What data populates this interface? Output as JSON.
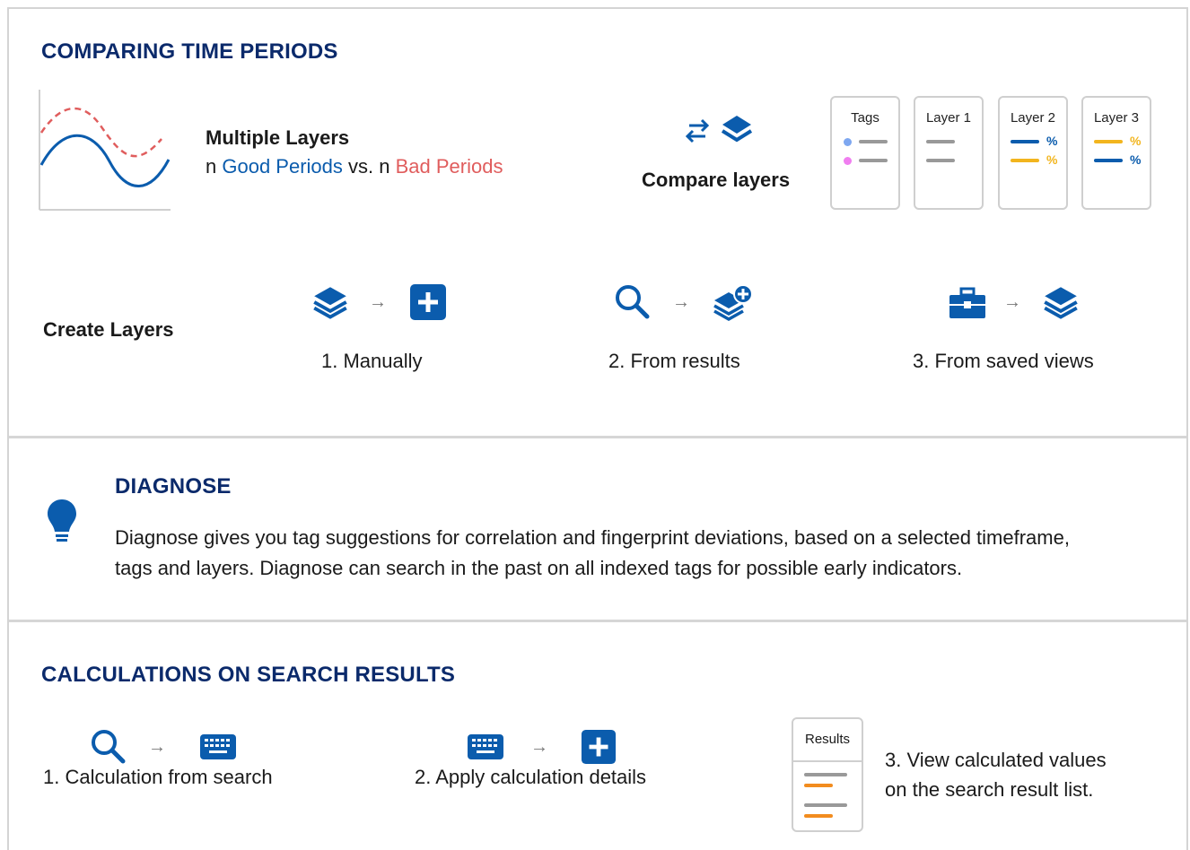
{
  "sections": {
    "comparing": {
      "title": "COMPARING TIME PERIODS",
      "multiple_layers_title": "Multiple Layers",
      "n1": "n",
      "good_periods": "Good Periods",
      "vs": "vs. n",
      "bad_periods": "Bad Periods",
      "compare_layers_label": "Compare layers",
      "legend_cards": [
        {
          "label": "Tags"
        },
        {
          "label": "Layer 1"
        },
        {
          "label": "Layer 2",
          "pct1": "%",
          "pct2": "%"
        },
        {
          "label": "Layer 3",
          "pct1": "%",
          "pct2": "%"
        }
      ],
      "create_layers_label": "Create Layers",
      "steps": [
        {
          "label": "1.  Manually"
        },
        {
          "label": "2.  From results"
        },
        {
          "label": "3.  From saved views"
        }
      ],
      "arrow": "→"
    },
    "diagnose": {
      "title": "DIAGNOSE",
      "line1": "Diagnose gives you tag suggestions for correlation and fingerprint deviations, based on a selected timeframe,",
      "line2": "tags and layers. Diagnose can search in the past on all indexed tags for possible early indicators."
    },
    "calculations": {
      "title": "CALCULATIONS ON SEARCH RESULTS",
      "step1": "1. Calculation from search",
      "step2": "2. Apply calculation details",
      "step3_line1": "3. View calculated values",
      "step3_line2": "on the search result list.",
      "results_card_label": "Results"
    }
  },
  "colors": {
    "title_navy": "#0b2a6b",
    "icon_blue": "#0b5cad",
    "good_blue": "#0b5cad",
    "bad_red": "#e05d5d",
    "orange": "#f28c1e",
    "yellow": "#f2b51e"
  }
}
